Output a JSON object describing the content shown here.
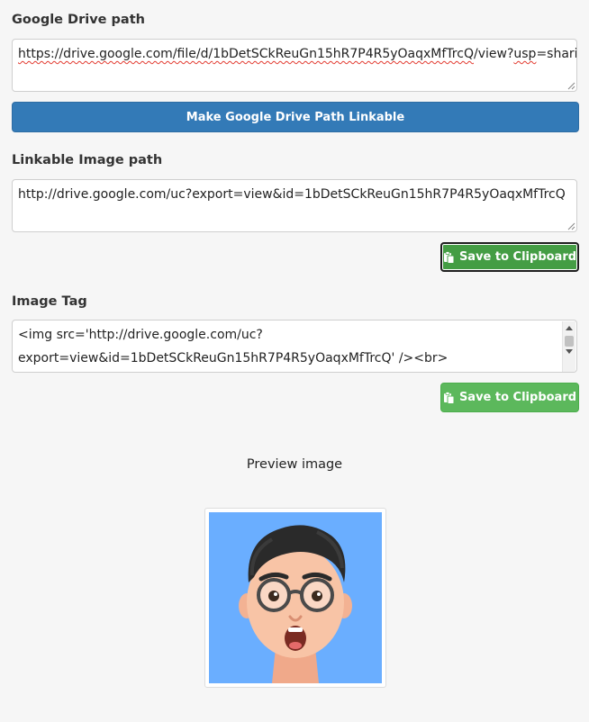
{
  "sections": {
    "drive": {
      "label": "Google Drive path",
      "value_plain": "https://drive.google.com/file/d/",
      "value_id": "1bDetSCkReuGn15hR7P4R5yOaqxMfTrcQ",
      "value_mid": "/view?",
      "value_usp": "usp",
      "value_tail": "=sharing",
      "button_label": "Make Google Drive Path Linkable"
    },
    "linkable": {
      "label": "Linkable Image path",
      "value": "http://drive.google.com/uc?export=view&id=1bDetSCkReuGn15hR7P4R5yOaqxMfTrcQ",
      "button_label": "Save to Clipboard"
    },
    "tag": {
      "label": "Image Tag",
      "line1": "<img src='http://drive.google.com/uc?",
      "line2": "export=view&id=1bDetSCkReuGn15hR7P4R5yOaqxMfTrcQ' /><br>",
      "button_label": "Save to Clipboard"
    }
  },
  "preview": {
    "title": "Preview image",
    "avatar_bg": "#6aaeff"
  },
  "colors": {
    "primary": "#337ab7",
    "success": "#5cb85c",
    "success_active": "#449d44",
    "background": "#f6f6f6"
  },
  "icons": {
    "clipboard": "clipboard-icon",
    "avatar": "memoji-avatar"
  }
}
